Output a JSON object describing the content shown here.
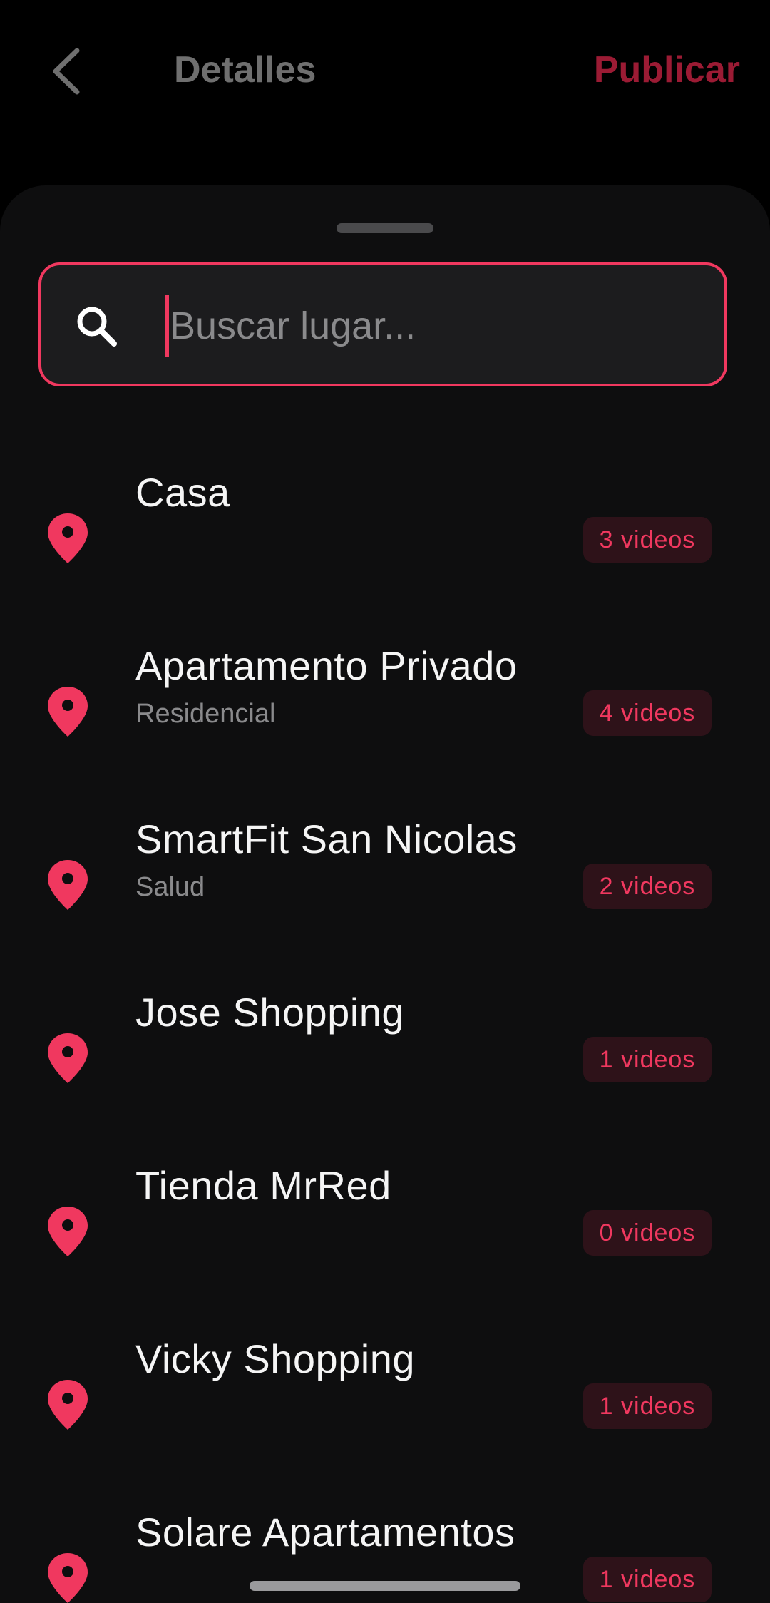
{
  "header": {
    "title": "Detalles",
    "publish_label": "Publicar",
    "back_icon": "chevron-left-icon"
  },
  "search": {
    "placeholder": "Buscar lugar...",
    "value": "",
    "icon": "search-icon"
  },
  "places": [
    {
      "name": "Casa",
      "subtitle": "",
      "badge": "3 videos"
    },
    {
      "name": "Apartamento Privado",
      "subtitle": "Residencial",
      "badge": "4 videos"
    },
    {
      "name": "SmartFit San Nicolas",
      "subtitle": "Salud",
      "badge": "2 videos"
    },
    {
      "name": "Jose Shopping",
      "subtitle": "",
      "badge": "1 videos"
    },
    {
      "name": "Tienda MrRed",
      "subtitle": "",
      "badge": "0 videos"
    },
    {
      "name": "Vicky Shopping",
      "subtitle": "",
      "badge": "1 videos"
    },
    {
      "name": "Solare Apartamentos",
      "subtitle": "",
      "badge": "1 videos"
    }
  ],
  "colors": {
    "accent": "#f0385f",
    "publish": "#9b1b34",
    "background": "#000000",
    "sheet": "#0e0e0f",
    "badge_bg": "#2e1219"
  }
}
